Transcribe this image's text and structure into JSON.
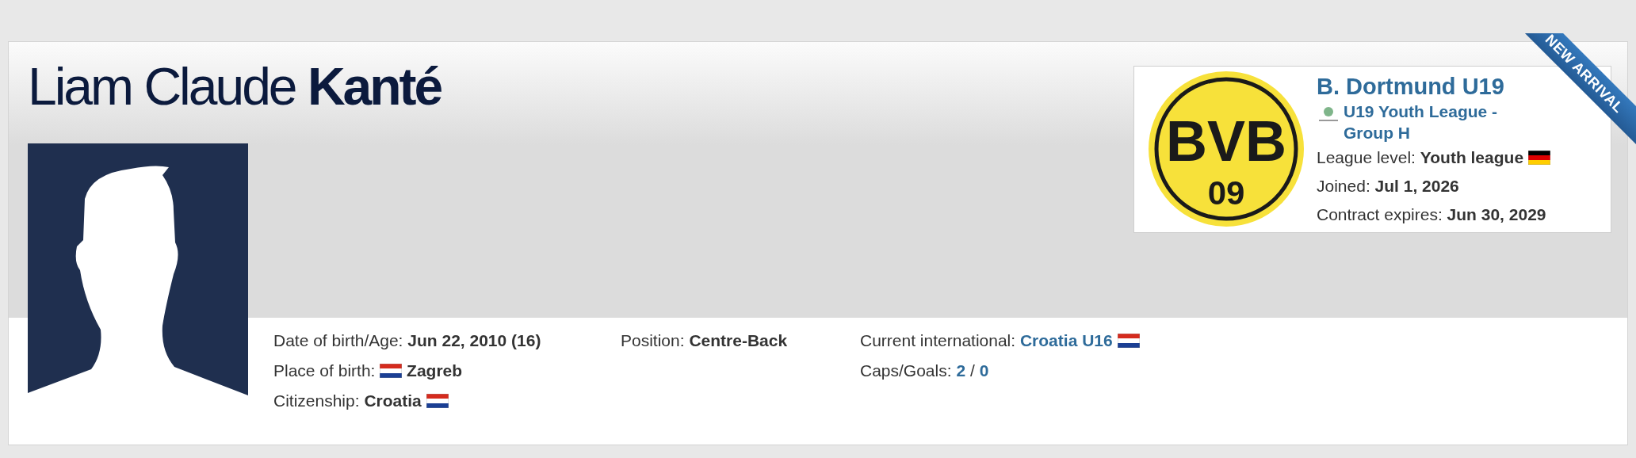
{
  "player": {
    "first_names": "Liam Claude",
    "surname": "Kanté"
  },
  "ribbon": {
    "text": "NEW ARRIVAL"
  },
  "club": {
    "name": "B. Dortmund U19",
    "logo_text": [
      "BVB",
      "09"
    ],
    "league": "U19 Youth League - Group H",
    "facts": [
      {
        "label": "League level:",
        "values": [
          {
            "text": "Youth league",
            "kind": "bold"
          }
        ],
        "flag": [
          {
            "color": "#000000"
          },
          {
            "color": "#dd0000"
          },
          {
            "color": "#ffce00"
          }
        ]
      },
      {
        "label": "Joined:",
        "values": [
          {
            "text": "Jul 1, 2026",
            "kind": "bold"
          }
        ]
      },
      {
        "label": "Contract expires:",
        "values": [
          {
            "text": "Jun 30, 2029",
            "kind": "bold"
          }
        ]
      }
    ]
  },
  "details": [
    [
      {
        "label": "Date of birth/Age:",
        "values": [
          {
            "text": "Jun 22, 2010 (16)",
            "kind": "bold"
          }
        ]
      },
      {
        "label": "Place of birth:",
        "flag": [
          {
            "color": "#d52b1e"
          },
          {
            "color": "#ffffff"
          },
          {
            "color": "#1b3f94"
          }
        ],
        "flag_first": true,
        "values": [
          {
            "text": "Zagreb",
            "kind": "bold"
          }
        ]
      },
      {
        "label": "Citizenship:",
        "values": [
          {
            "text": "Croatia",
            "kind": "bold"
          }
        ],
        "flag": [
          {
            "color": "#d52b1e"
          },
          {
            "color": "#ffffff"
          },
          {
            "color": "#1b3f94"
          }
        ]
      }
    ],
    [
      {
        "label": "Position:",
        "values": [
          {
            "text": "Centre-Back",
            "kind": "bold"
          }
        ]
      }
    ],
    [
      {
        "label": "Current international:",
        "values": [
          {
            "text": "Croatia U16",
            "kind": "link"
          }
        ],
        "flag": [
          {
            "color": "#d52b1e"
          },
          {
            "color": "#ffffff"
          },
          {
            "color": "#1b3f94"
          }
        ]
      },
      {
        "label": "Caps/Goals:",
        "values": [
          {
            "text": "2",
            "kind": "link"
          },
          {
            "text": "/",
            "kind": "plain"
          },
          {
            "text": "0",
            "kind": "link"
          }
        ]
      }
    ]
  ]
}
